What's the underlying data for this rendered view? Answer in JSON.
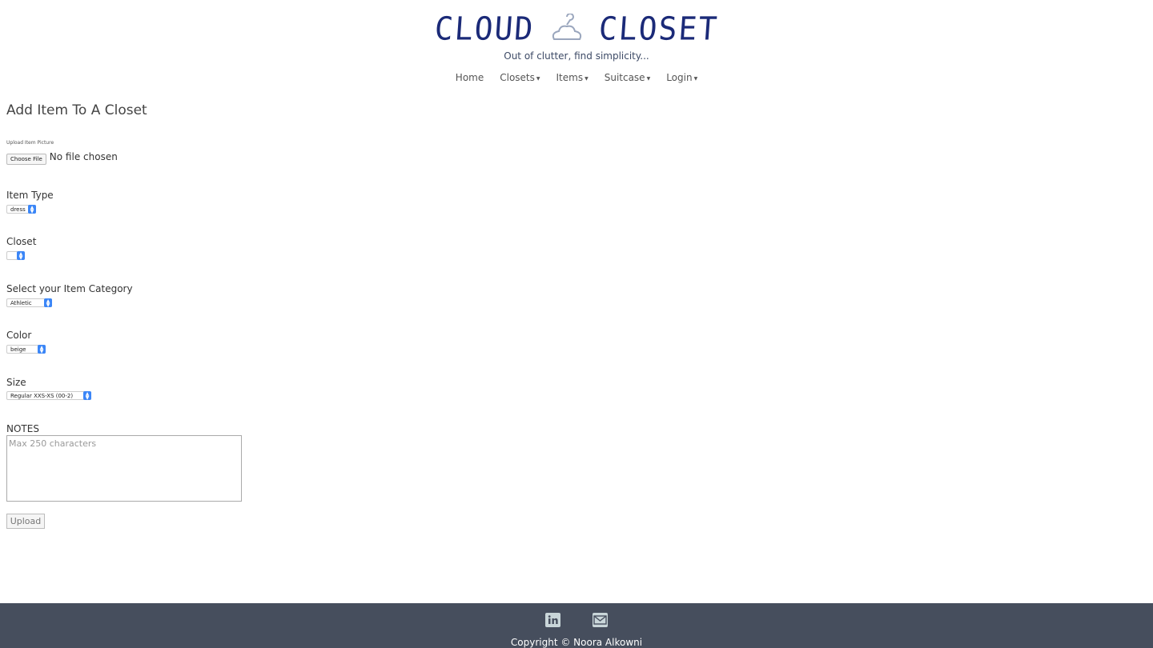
{
  "brand": {
    "word_left": "CLOUD",
    "word_right": "CLOSET",
    "tagline": "Out of clutter, find simplicity..."
  },
  "nav": {
    "items": [
      {
        "label": "Home",
        "dropdown": false
      },
      {
        "label": "Closets",
        "dropdown": true
      },
      {
        "label": "Items",
        "dropdown": true
      },
      {
        "label": "Suitcase",
        "dropdown": true
      },
      {
        "label": "Login",
        "dropdown": true
      }
    ]
  },
  "page": {
    "title": "Add Item To A Closet"
  },
  "form": {
    "upload_label": "Upload Item Picture",
    "file_button": "Choose File",
    "file_status": "No file chosen",
    "item_type": {
      "label": "Item Type",
      "value": "dress"
    },
    "closet": {
      "label": "Closet",
      "value": ""
    },
    "category": {
      "label": "Select your Item Category",
      "value": "Athletic"
    },
    "color": {
      "label": "Color",
      "value": "beige"
    },
    "size": {
      "label": "Size",
      "value": "Regular XXS-XS (00-2)"
    },
    "notes": {
      "label": "NOTES",
      "placeholder": "Max 250 characters"
    },
    "submit": "Upload"
  },
  "footer": {
    "icons": [
      "linkedin-icon",
      "email-icon"
    ],
    "copyright": "Copyright © Noora Alkowni",
    "bg_color": "#464e5d"
  },
  "colors": {
    "brand": "#1b2a78",
    "select_arrow": "#3b86f7"
  }
}
